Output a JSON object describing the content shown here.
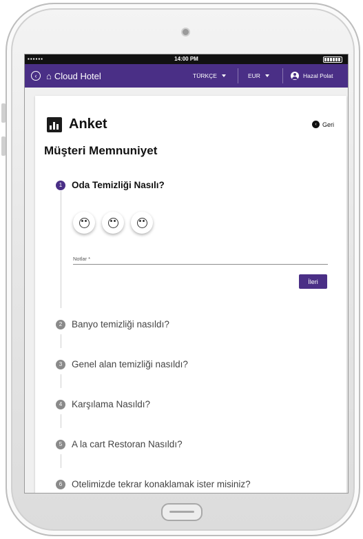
{
  "status_bar": {
    "signal": "▪▪▪▪▪▪",
    "time": "14:00 PM"
  },
  "appbar": {
    "back_icon": "circle-chevron-left-icon",
    "home_icon": "home-icon",
    "brand": "Cloud Hotel",
    "language": "TÜRKÇE",
    "currency": "EUR",
    "user_name": "Hazal Polat",
    "accent_color": "#4a2f86"
  },
  "survey": {
    "title": "Anket",
    "back_label": "Geri",
    "subtitle": "Müşteri Memnuniyet",
    "steps": [
      {
        "number": "1",
        "label": "Oda Temizliği Nasılı?"
      },
      {
        "number": "2",
        "label": "Banyo temizliği nasıldı?"
      },
      {
        "number": "3",
        "label": "Genel alan temizliği nasıldı?"
      },
      {
        "number": "4",
        "label": "Karşılama Nasıldı?"
      },
      {
        "number": "5",
        "label": "A la cart Restoran Nasıldı?"
      },
      {
        "number": "6",
        "label": "Otelimizde tekrar konaklamak ister misiniz?"
      }
    ],
    "ratings": [
      "angry-face-icon",
      "neutral-face-icon",
      "happy-face-icon"
    ],
    "notes_label": "Notlar *",
    "notes_value": "",
    "next_label": "İleri"
  }
}
